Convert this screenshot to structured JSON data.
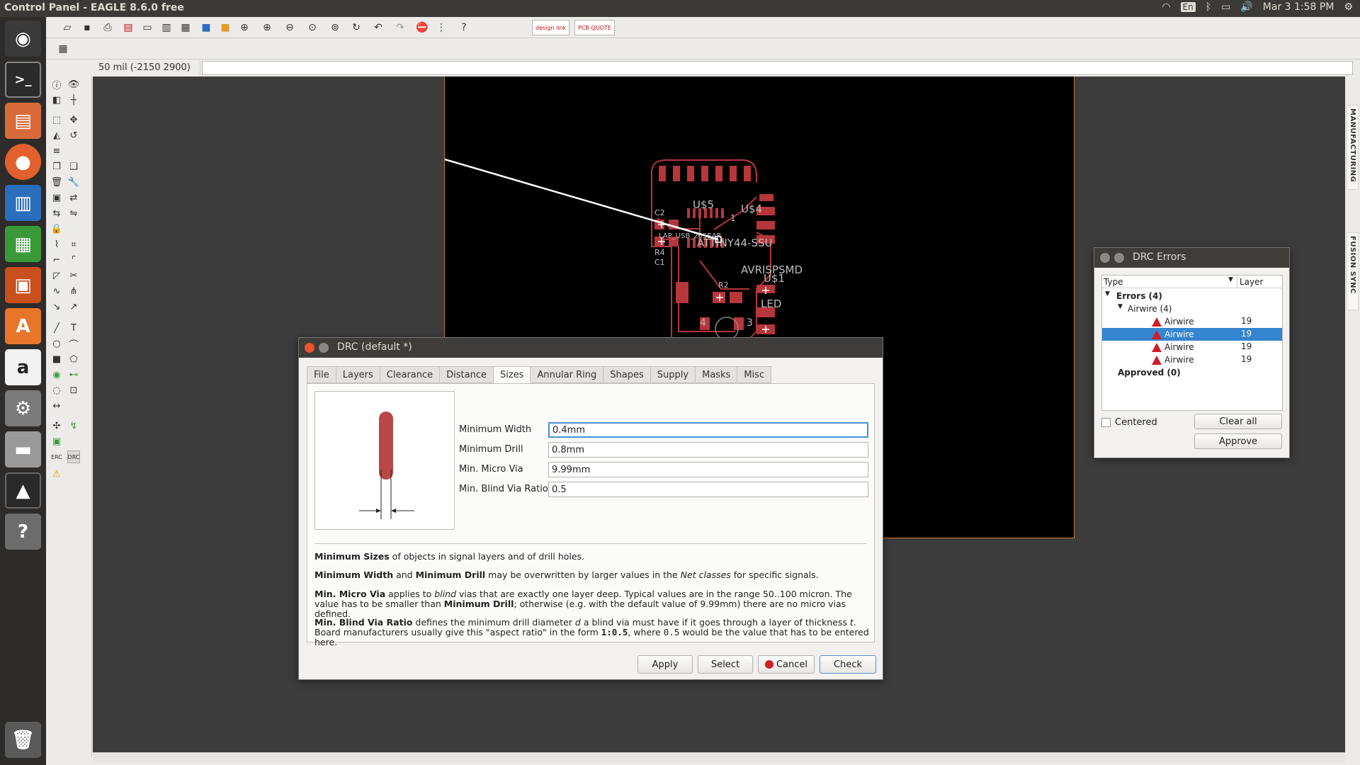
{
  "window": {
    "title": "Control Panel - EAGLE 8.6.0 free"
  },
  "tray": {
    "lang": "En",
    "datetime": "Mar 3  1:58 PM"
  },
  "toolbar": {
    "design_link_label": "design link",
    "pcb_quote_label": "PCB QUOTE"
  },
  "status": {
    "coordinates": "50 mil (-2150 2900)",
    "command": ""
  },
  "left_tools": {
    "erc_label": "ERC",
    "drc_label": "DRC"
  },
  "right_panel": {
    "manufacturing": "MANUFACTURING",
    "fusion_sync": "FUSION SYNC"
  },
  "board": {
    "labels": {
      "c2": "C2",
      "c1": "C1",
      "r4": "R4",
      "r2": "R2",
      "u5": "U$5",
      "u4": "U$4",
      "u1": "U$1",
      "one": "1",
      "ic": "ATTINY44-SSU",
      "ic2": "LAP_USB_20SEAR",
      "avr": "AVRISPSMD",
      "led": "LED",
      "four": "4",
      "three": "3"
    }
  },
  "drc": {
    "title": "DRC (default *)",
    "tabs": [
      "File",
      "Layers",
      "Clearance",
      "Distance",
      "Sizes",
      "Annular Ring",
      "Shapes",
      "Supply",
      "Masks",
      "Misc"
    ],
    "active_tab": "Sizes",
    "fields": [
      {
        "label": "Minimum Width",
        "value": "0.4mm"
      },
      {
        "label": "Minimum Drill",
        "value": "0.8mm"
      },
      {
        "label": "Min. Micro Via",
        "value": "9.99mm"
      },
      {
        "label": "Min. Blind Via Ratio",
        "value": "0.5"
      }
    ],
    "help": {
      "p1_b": "Minimum Sizes",
      "p1_t": " of objects in signal layers and of drill holes.",
      "p2_b1": "Minimum Width",
      "p2_t1": " and ",
      "p2_b2": "Minimum Drill",
      "p2_t2": " may be overwritten by larger values in the ",
      "p2_i": "Net classes",
      "p2_t3": " for specific signals.",
      "p3_b1": "Min. Micro Via",
      "p3_t1": " applies to ",
      "p3_i": "blind",
      "p3_t2": " vias that are exactly one layer deep. Typical values are in the range 50..100 micron. The value has to be smaller than ",
      "p3_b2": "Minimum Drill",
      "p3_t3": "; otherwise (e.g. with the default value of 9.99mm) there are no micro vias defined.",
      "p4_b1": "Min. Blind Via Ratio",
      "p4_t1": " defines the minimum drill diameter ",
      "p4_i1": "d",
      "p4_t2": " a blind via must have if it goes through a layer of thickness ",
      "p4_i2": "t",
      "p4_t3": ". Board manufacturers usually give this \"aspect ratio\" in the form ",
      "p4_m1": "1:0.5",
      "p4_t4": ", where ",
      "p4_m2": "0.5",
      "p4_t5": " would be the value that has to be entered here."
    },
    "buttons": {
      "apply": "Apply",
      "select": "Select",
      "cancel": "Cancel",
      "check": "Check"
    }
  },
  "drc_errors": {
    "title": "DRC Errors",
    "col_type": "Type",
    "col_layer": "Layer",
    "errors_label": "Errors (4)",
    "airwire_group": "Airwire (4)",
    "rows": [
      {
        "type": "Airwire",
        "layer": "19"
      },
      {
        "type": "Airwire",
        "layer": "19"
      },
      {
        "type": "Airwire",
        "layer": "19"
      },
      {
        "type": "Airwire",
        "layer": "19"
      }
    ],
    "approved_label": "Approved (0)",
    "centered_label": "Centered",
    "clear_all": "Clear all",
    "approve": "Approve"
  },
  "colors": {
    "accent": "#3584cf",
    "trace": "#b6363b",
    "board_outline": "#c07c1e"
  }
}
